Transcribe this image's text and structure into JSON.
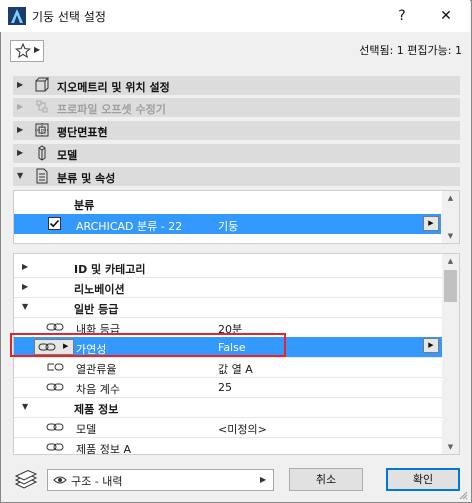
{
  "window": {
    "title": "기둥 선택 설정",
    "help_label": "?",
    "close_label": "✕"
  },
  "favorites": {
    "status_text": "선택됨: 1 편집가능: 1"
  },
  "panels": [
    {
      "label": "지오메트리 및 위치 설정",
      "expanded": false,
      "enabled": true
    },
    {
      "label": "프로파일 오프셋 수정기",
      "expanded": false,
      "enabled": false
    },
    {
      "label": "평단면표현",
      "expanded": false,
      "enabled": true
    },
    {
      "label": "모델",
      "expanded": false,
      "enabled": true
    },
    {
      "label": "분류 및 속성",
      "expanded": true,
      "enabled": true
    }
  ],
  "classification": {
    "header": "분류",
    "row": {
      "checked": true,
      "name": "ARCHICAD 분류 - 22",
      "value": "기둥"
    }
  },
  "properties": {
    "rows": [
      {
        "kind": "group",
        "expanded": false,
        "name": "ID 및 카테고리"
      },
      {
        "kind": "group",
        "expanded": false,
        "name": "리노베이션"
      },
      {
        "kind": "group",
        "expanded": true,
        "name": "일반 등급"
      },
      {
        "kind": "prop",
        "name": "내화 등급",
        "value": "20분",
        "selected": false
      },
      {
        "kind": "prop",
        "name": "가연성",
        "value": "False",
        "selected": true
      },
      {
        "kind": "prop",
        "name": "열관류율",
        "value": "값 열 A",
        "selected": false
      },
      {
        "kind": "prop",
        "name": "차음 계수",
        "value": "25",
        "selected": false
      },
      {
        "kind": "group",
        "expanded": true,
        "name": "제품 정보"
      },
      {
        "kind": "prop",
        "name": "모델",
        "value": "<미정의>",
        "selected": false
      },
      {
        "kind": "prop",
        "name": "제품 정보 A",
        "value": "",
        "selected": false
      }
    ]
  },
  "footer": {
    "layer_value": "구조 - 내력",
    "cancel_label": "취소",
    "ok_label": "확인"
  },
  "colors": {
    "selection": "#3399ff",
    "highlight_box": "#e2262c",
    "panel_bg": "#dcdcdc"
  }
}
